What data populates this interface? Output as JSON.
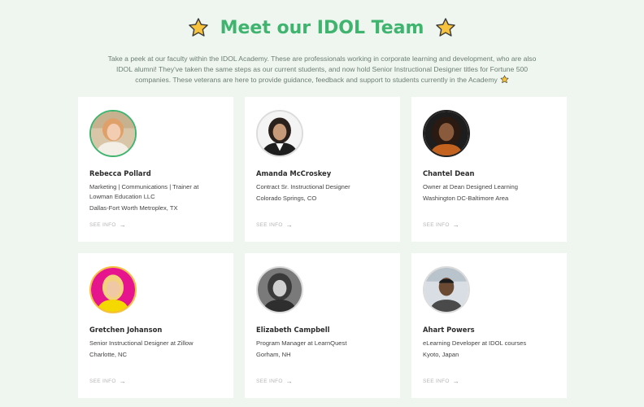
{
  "header": {
    "title": "Meet our IDOL Team",
    "intro": "Take a peek at our faculty within the IDOL Academy. These are professionals working in corporate learning and development, who are also IDOL alumni! They've taken the same steps as our current students, and now hold Senior Instructional Designer titles for Fortune 500 companies. These veterans are here to provide guidance, feedback and support to students currently in the Academy"
  },
  "colors": {
    "accent": "#3fb46f",
    "background": "#eef6ef",
    "star": "#f7c23c"
  },
  "see_info_label": "SEE INFO",
  "team": [
    {
      "name": "Rebecca Pollard",
      "role": "Marketing | Communications | Trainer at Lowman Education LLC",
      "location": "Dallas-Fort Worth Metroplex, TX",
      "ring": "#3fb46f"
    },
    {
      "name": "Amanda McCroskey",
      "role": "Contract Sr. Instructional Designer",
      "location": "Colorado Springs, CO",
      "ring": "#dddddd"
    },
    {
      "name": "Chantel Dean",
      "role": "Owner at Dean Designed Learning",
      "location": "Washington DC-Baltimore Area",
      "ring": "#222222"
    },
    {
      "name": "Gretchen Johanson",
      "role": "Senior Instructional Designer at Zillow",
      "location": "Charlotte, NC",
      "ring": "#f7c23c"
    },
    {
      "name": "Elizabeth Campbell",
      "role": "Program Manager at LearnQuest",
      "location": "Gorham, NH",
      "ring": "#dddddd"
    },
    {
      "name": "Ahart Powers",
      "role": "eLearning Developer at IDOL courses",
      "location": "Kyoto, Japan",
      "ring": "#dddddd"
    }
  ]
}
